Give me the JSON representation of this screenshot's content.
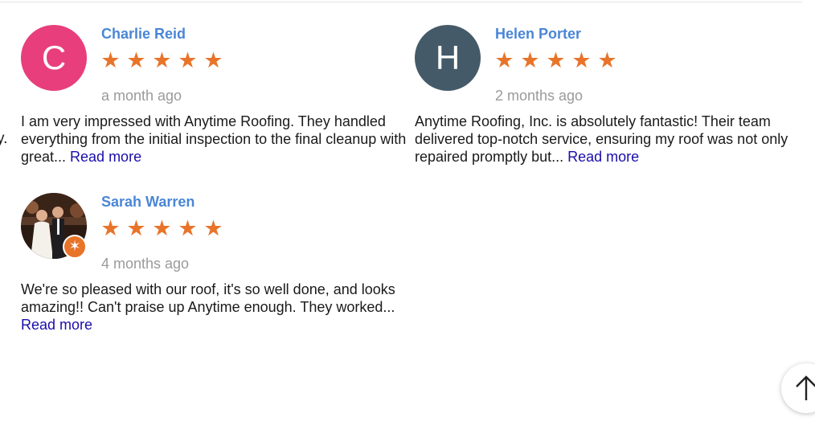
{
  "cut_off_text": "y.",
  "reviews": [
    {
      "initial": "C",
      "avatar_color": "#e83e7c",
      "name": "Charlie Reid",
      "stars": [
        "★",
        "★",
        "★",
        "★",
        "★"
      ],
      "time": "a month ago",
      "text": "I am very impressed with Anytime Roofing. They handled everything from the initial inspection to the final cleanup with great... ",
      "read_more": "Read more"
    },
    {
      "initial": "H",
      "avatar_color": "#455a68",
      "name": "Helen Porter",
      "stars": [
        "★",
        "★",
        "★",
        "★",
        "★"
      ],
      "time": "2 months ago",
      "text": "Anytime Roofing, Inc. is absolutely fantastic! Their team delivered top-notch service, ensuring my roof was not only repaired promptly but... ",
      "read_more": "Read more"
    },
    {
      "avatar_icon": "profile-photo",
      "badge_icon": "star-badge-icon",
      "badge_glyph": "✶",
      "name": "Sarah Warren",
      "stars": [
        "★",
        "★",
        "★",
        "★",
        "★"
      ],
      "time": "4 months ago",
      "text": "We're so pleased with our roof, it's so well done, and looks amazing!! Can't praise up Anytime enough. They worked... ",
      "read_more": "Read more"
    }
  ],
  "colors": {
    "name": "#4a86d6",
    "star": "#e8742a",
    "time": "#9a9a9a",
    "link": "#1a0dab"
  },
  "scroll_top_icon": "arrow-up-icon"
}
